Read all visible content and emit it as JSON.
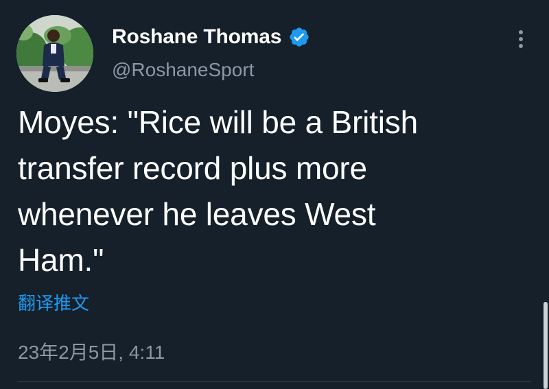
{
  "tweet": {
    "author": {
      "display_name": "Roshane Thomas",
      "handle": "@RoshaneSport",
      "verified": true
    },
    "text": "Moyes: \"Rice will be a British\ntransfer record plus more\nwhenever he leaves West\nHam.\"",
    "translate_label": "翻译推文",
    "timestamp": "23年2月5日, 4:11"
  },
  "icons": {
    "verified": "verified-badge-icon",
    "more": "more-options-icon"
  },
  "colors": {
    "background": "#15202b",
    "accent": "#1d9bf0",
    "secondary_text": "#8b98a5"
  }
}
